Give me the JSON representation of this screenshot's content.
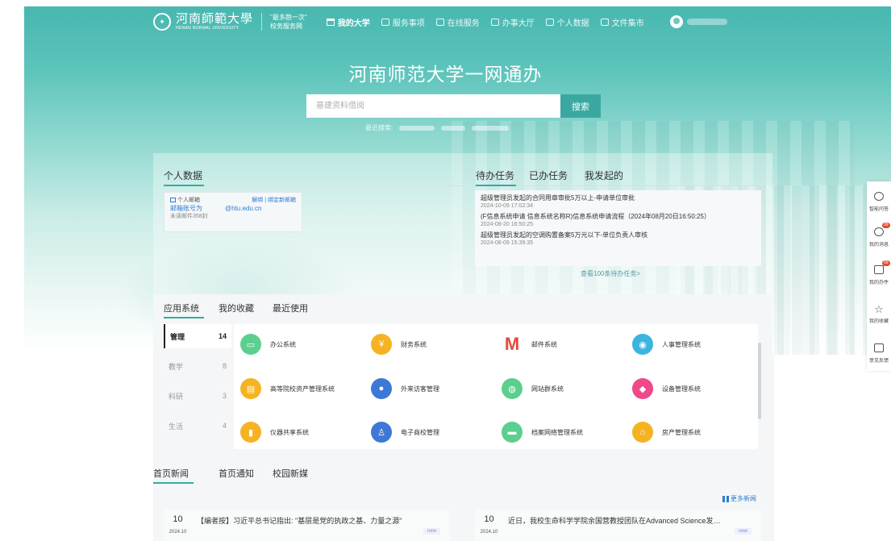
{
  "colors": {
    "accent": "#3aa8a0",
    "link": "#2f7bd1",
    "badge": "#e34b2f"
  },
  "nav": {
    "logo_cn": "河南師範大學",
    "logo_en": "HENAN NORMAL UNIVERSITY",
    "slogan_line1": "\"最多跑一次\"",
    "slogan_line2": "校务服务网",
    "items": [
      {
        "label": "我的大学",
        "icon": "home-icon"
      },
      {
        "label": "服务事项",
        "icon": "list-icon"
      },
      {
        "label": "在线服务",
        "icon": "list-icon"
      },
      {
        "label": "办事大厅",
        "icon": "list-icon"
      },
      {
        "label": "个人数据",
        "icon": "list-icon"
      },
      {
        "label": "文件集市",
        "icon": "list-icon"
      }
    ]
  },
  "hero": {
    "title": "河南师范大学一网通办",
    "search_placeholder": "基建资料借阅",
    "search_button": "搜索",
    "recent_label": "最近搜索:"
  },
  "personal": {
    "title": "个人数据",
    "mail_label": "个人邮箱",
    "mail_links": "解绑 | 绑定新邮箱",
    "mail_account_prefix": "邮箱账号为",
    "mail_account_suffix": "@htu.edu.cn",
    "unread": "未读邮件358封"
  },
  "tasks": {
    "tabs": [
      "待办任务",
      "已办任务",
      "我发起的"
    ],
    "items": [
      {
        "title": "超级管理员发起的合同用章审批5万以上-申请单位审批",
        "date": "2024-10-09 17:02:34"
      },
      {
        "title": "(F信息系统申请 信息系统名称R)信息系统申请流程（2024年08月20日16:50:25）",
        "date": "2024-08-20 16:50:25"
      },
      {
        "title": "超级管理员发起的空调购置备案5万元以下-单位负责人审核",
        "date": "2024-08-09 15:39:35"
      }
    ],
    "more": "查看100条待办任务>"
  },
  "apps": {
    "tabs": [
      "应用系统",
      "我的收藏",
      "最近使用"
    ],
    "categories": [
      {
        "name": "管理",
        "count": "14"
      },
      {
        "name": "教学",
        "count": "8"
      },
      {
        "name": "科研",
        "count": "3"
      },
      {
        "name": "生活",
        "count": "4"
      }
    ],
    "items": [
      {
        "name": "办公系统",
        "color": "#5ccf8e",
        "glyph": "▭"
      },
      {
        "name": "财务系统",
        "color": "#f5b324",
        "glyph": "¥"
      },
      {
        "name": "邮件系统",
        "color": "#e64a3b",
        "glyph": "M"
      },
      {
        "name": "人事管理系统",
        "color": "#3bb5e0",
        "glyph": "◉"
      },
      {
        "name": "高等院校资产管理系统",
        "color": "#f5b324",
        "glyph": "▤"
      },
      {
        "name": "外来访客管理",
        "color": "#3e78d6",
        "glyph": "●"
      },
      {
        "name": "网站群系统",
        "color": "#5ccf8e",
        "glyph": "◍"
      },
      {
        "name": "设备管理系统",
        "color": "#f0488a",
        "glyph": "◆"
      },
      {
        "name": "仪器共享系统",
        "color": "#f5b324",
        "glyph": "▮"
      },
      {
        "name": "电子商校管理",
        "color": "#3e78d6",
        "glyph": "♙"
      },
      {
        "name": "档案网络管理系统",
        "color": "#5ccf8e",
        "glyph": "▬"
      },
      {
        "name": "房产管理系统",
        "color": "#f5b324",
        "glyph": "⌂"
      }
    ]
  },
  "news": {
    "tabs": [
      "首页新闻",
      "首页通知",
      "校园新媒"
    ],
    "more": "更多新闻",
    "items": [
      {
        "day": "10",
        "month": "2024.10",
        "title": "【编者按】习近平总书记指出: \"基层是党的执政之基、力量之源\"",
        "badge": "new"
      },
      {
        "day": "10",
        "month": "2024.10",
        "title": "近日，我校生命科学学院余国营教授团队在Advanced Science发表研究成果",
        "badge": "new"
      }
    ]
  },
  "floatbar": [
    {
      "label": "智能问答",
      "icon": "robot-icon",
      "badge": ""
    },
    {
      "label": "我的消息",
      "icon": "message-icon",
      "badge": "99"
    },
    {
      "label": "我的办件",
      "icon": "document-icon",
      "badge": "99"
    },
    {
      "label": "我的收藏",
      "icon": "star-icon",
      "badge": ""
    },
    {
      "label": "意见反馈",
      "icon": "feedback-icon",
      "badge": ""
    }
  ]
}
